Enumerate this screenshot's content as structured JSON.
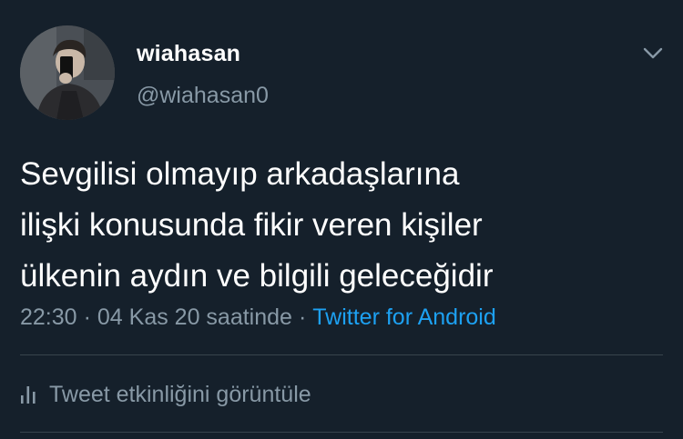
{
  "user": {
    "display_name": "wiahasan",
    "handle": "@wiahasan0",
    "avatar_icon": "profile-photo"
  },
  "tweet": {
    "lines": [
      "Sevgilisi olmayıp arkadaşlarına",
      "ilişki konusunda fikir veren kişiler",
      "ülkenin aydın ve bilgili geleceğidir"
    ],
    "time": "22:30",
    "date_suffix": "04 Kas 20 saatinde",
    "source": "Twitter for Android",
    "separator": "·"
  },
  "actions": {
    "activity_label": "Tweet etkinliğini görüntüle",
    "activity_icon": "bar-chart-icon",
    "menu_icon": "chevron-down-icon"
  },
  "colors": {
    "background": "#15202b",
    "primary_text": "#ffffff",
    "secondary_text": "#8899a6",
    "link": "#1da1f2",
    "divider": "#38444d"
  }
}
